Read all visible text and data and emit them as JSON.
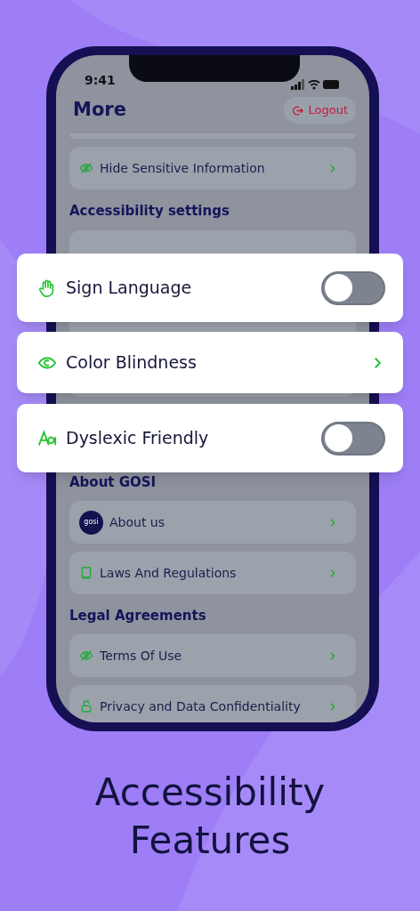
{
  "status_bar": {
    "time": "9:41"
  },
  "header": {
    "title": "More",
    "logout": "Logout"
  },
  "sections": [
    {
      "kind": "list",
      "items": [
        {
          "label": "Hide Sensitive Information",
          "kind": "icon"
        }
      ]
    },
    {
      "kind": "heading",
      "title": "Accessibility settings"
    },
    {
      "kind": "hidden_card"
    },
    {
      "kind": "heading",
      "title": "About GOSI"
    },
    {
      "kind": "list",
      "items": [
        {
          "label": "About us",
          "kind": "logo",
          "logo_text": "gosi"
        },
        {
          "label": "Laws And Regulations",
          "kind": "icon"
        }
      ]
    },
    {
      "kind": "heading",
      "title": "Legal Agreements"
    },
    {
      "kind": "list",
      "items": [
        {
          "label": "Terms Of Use",
          "kind": "icon"
        },
        {
          "label": "Privacy and Data Confidentiality",
          "kind": "icon"
        }
      ]
    }
  ],
  "highlight_cards": [
    {
      "label": "Sign Language",
      "kind": "toggle",
      "on": false
    },
    {
      "label": "Color Blindness",
      "kind": "link"
    },
    {
      "label": "Dyslexic Friendly",
      "kind": "toggle",
      "on": false
    }
  ],
  "caption": [
    "Accessibility",
    "Features"
  ]
}
